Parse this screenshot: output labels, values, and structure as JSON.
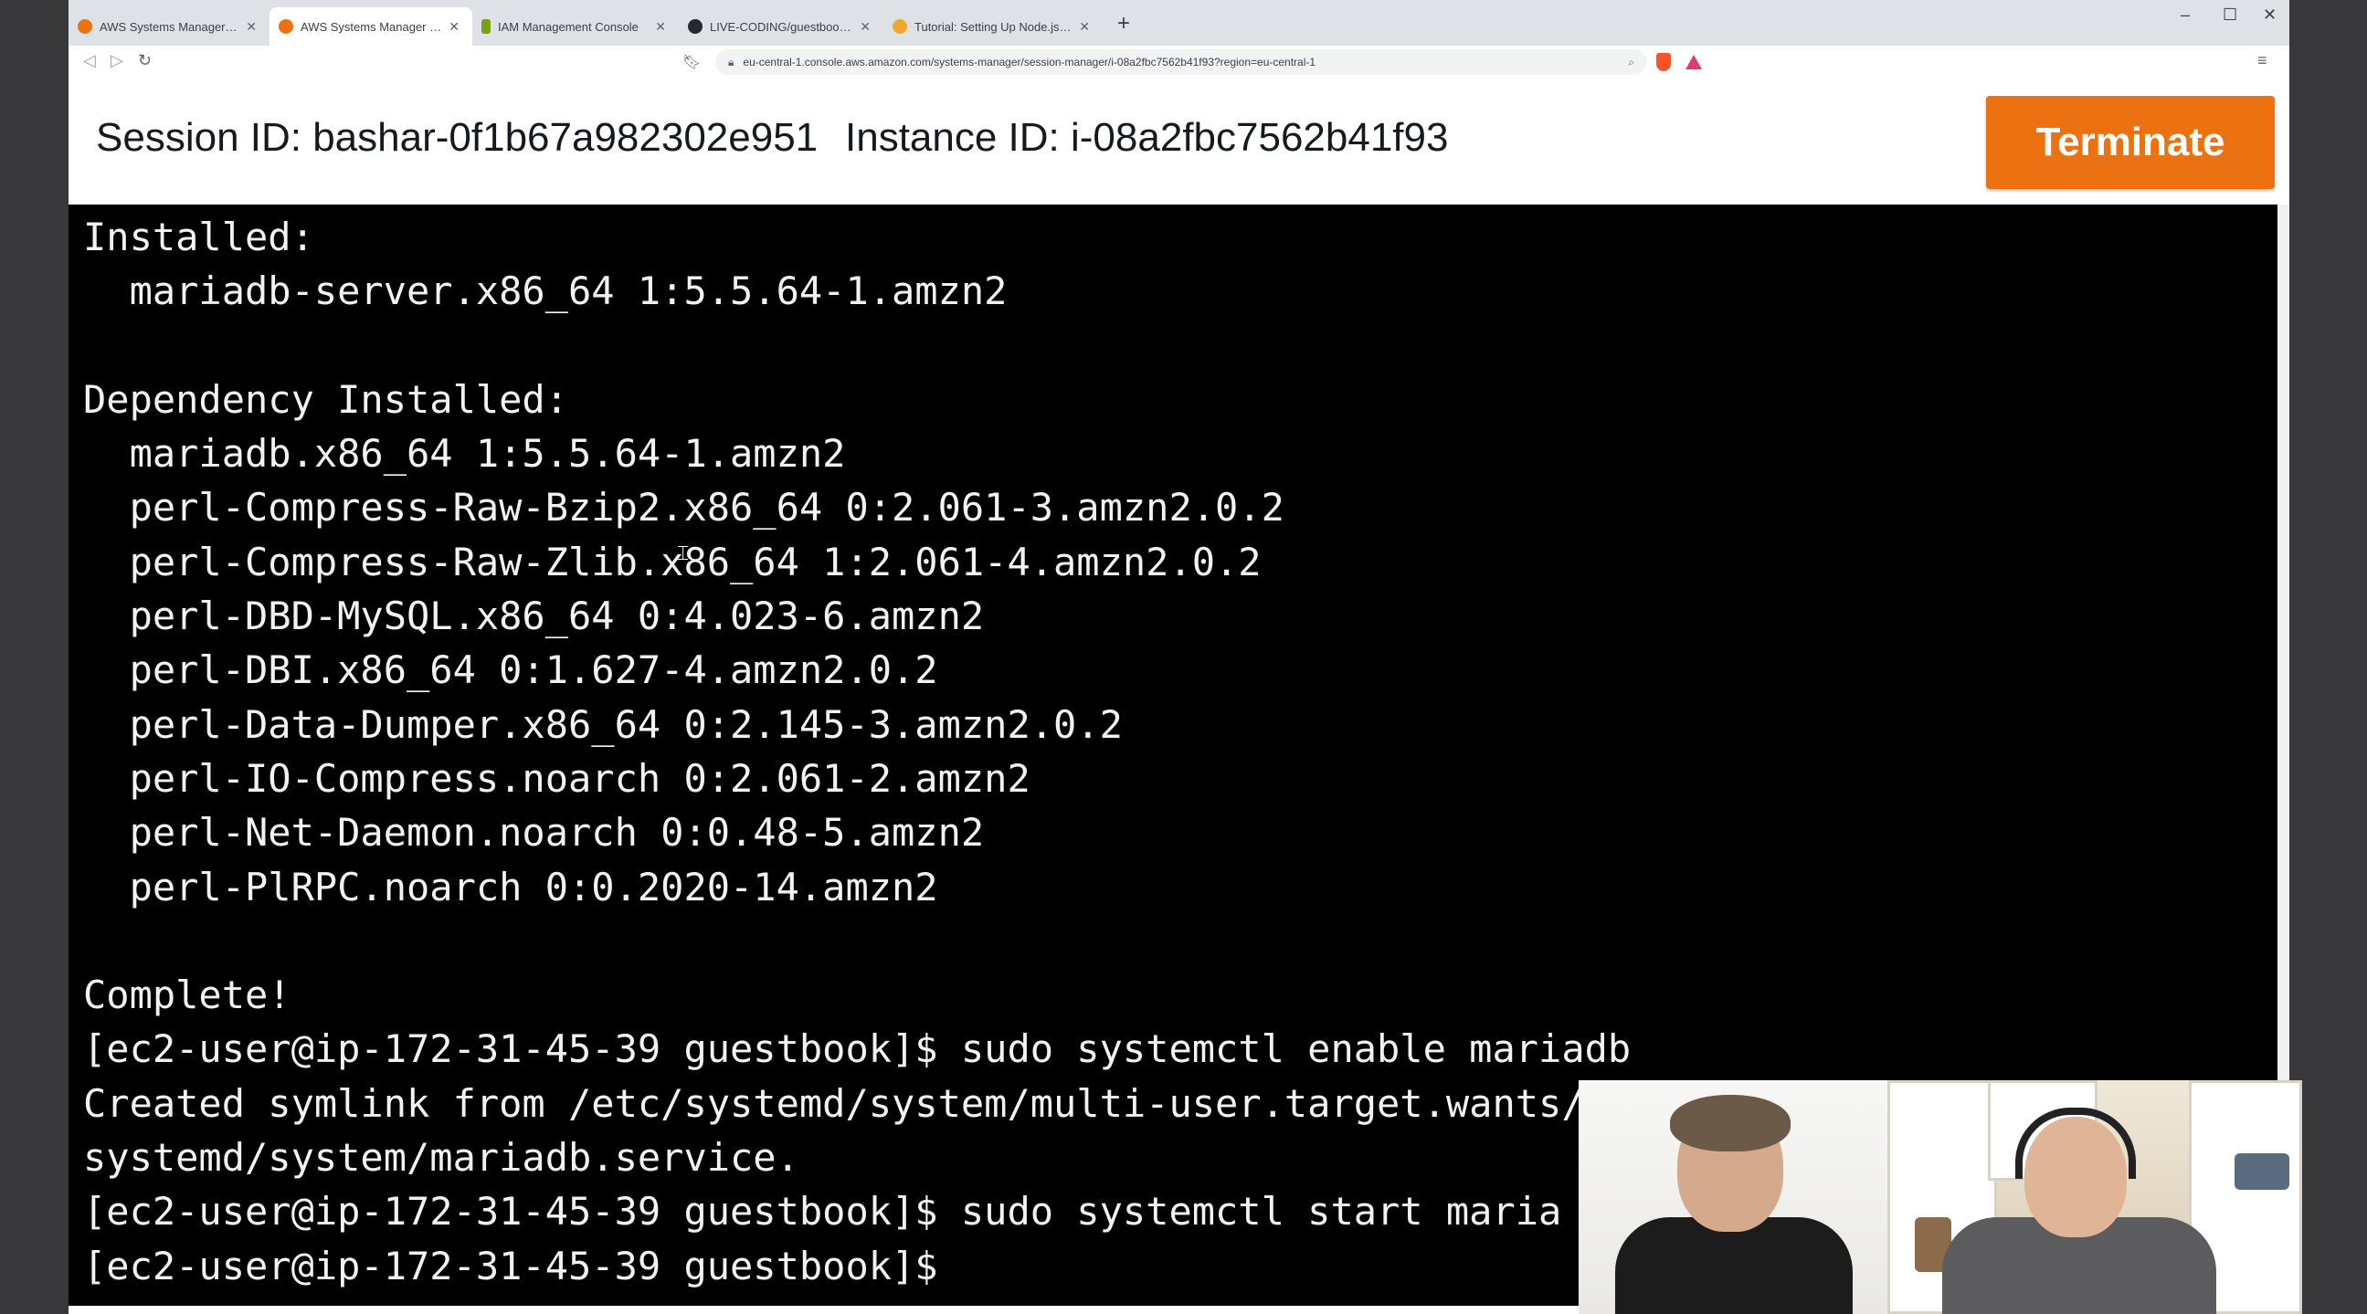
{
  "browser": {
    "tabs": [
      {
        "title": "AWS Systems Manager - Session M",
        "active": false,
        "favicon": "aws-icon",
        "color": "#ec7211"
      },
      {
        "title": "AWS Systems Manager - Session M",
        "active": true,
        "favicon": "aws-icon",
        "color": "#ec7211"
      },
      {
        "title": "IAM Management Console",
        "active": false,
        "favicon": "aws-iam-icon",
        "color": "#7aa116"
      },
      {
        "title": "LIVE-CODING/guestbook-app at m",
        "active": false,
        "favicon": "github-icon",
        "color": "#24292e"
      },
      {
        "title": "Tutorial: Setting Up Node.js on an",
        "active": false,
        "favicon": "aws-docs-icon",
        "color": "#f0a92e"
      }
    ],
    "url": "eu-central-1.console.aws.amazon.com/systems-manager/session-manager/i-08a2fbc7562b41f93?region=eu-central-1"
  },
  "session": {
    "session_id": "Session ID: bashar-0f1b67a982302e951",
    "instance_id": "Instance ID: i-08a2fbc7562b41f93",
    "terminate_label": "Terminate"
  },
  "terminal": {
    "lines": [
      "Installed:",
      "  mariadb-server.x86_64 1:5.5.64-1.amzn2",
      "",
      "Dependency Installed:",
      "  mariadb.x86_64 1:5.5.64-1.amzn2",
      "  perl-Compress-Raw-Bzip2.x86_64 0:2.061-3.amzn2.0.2",
      "  perl-Compress-Raw-Zlib.x86_64 1:2.061-4.amzn2.0.2",
      "  perl-DBD-MySQL.x86_64 0:4.023-6.amzn2",
      "  perl-DBI.x86_64 0:1.627-4.amzn2.0.2",
      "  perl-Data-Dumper.x86_64 0:2.145-3.amzn2.0.2",
      "  perl-IO-Compress.noarch 0:2.061-2.amzn2",
      "  perl-Net-Daemon.noarch 0:0.48-5.amzn2",
      "  perl-PlRPC.noarch 0:0.2020-14.amzn2",
      "",
      "Complete!",
      "[ec2-user@ip-172-31-45-39 guestbook]$ sudo systemctl enable mariadb",
      "Created symlink from /etc/systemd/system/multi-user.target.wants/",
      "systemd/system/mariadb.service.",
      "[ec2-user@ip-172-31-45-39 guestbook]$ sudo systemctl start maria",
      "[ec2-user@ip-172-31-45-39 guestbook]$"
    ]
  },
  "colors": {
    "terminate_button": "#ec7211",
    "terminal_bg": "#000000",
    "terminal_fg": "#f2f2f2"
  }
}
